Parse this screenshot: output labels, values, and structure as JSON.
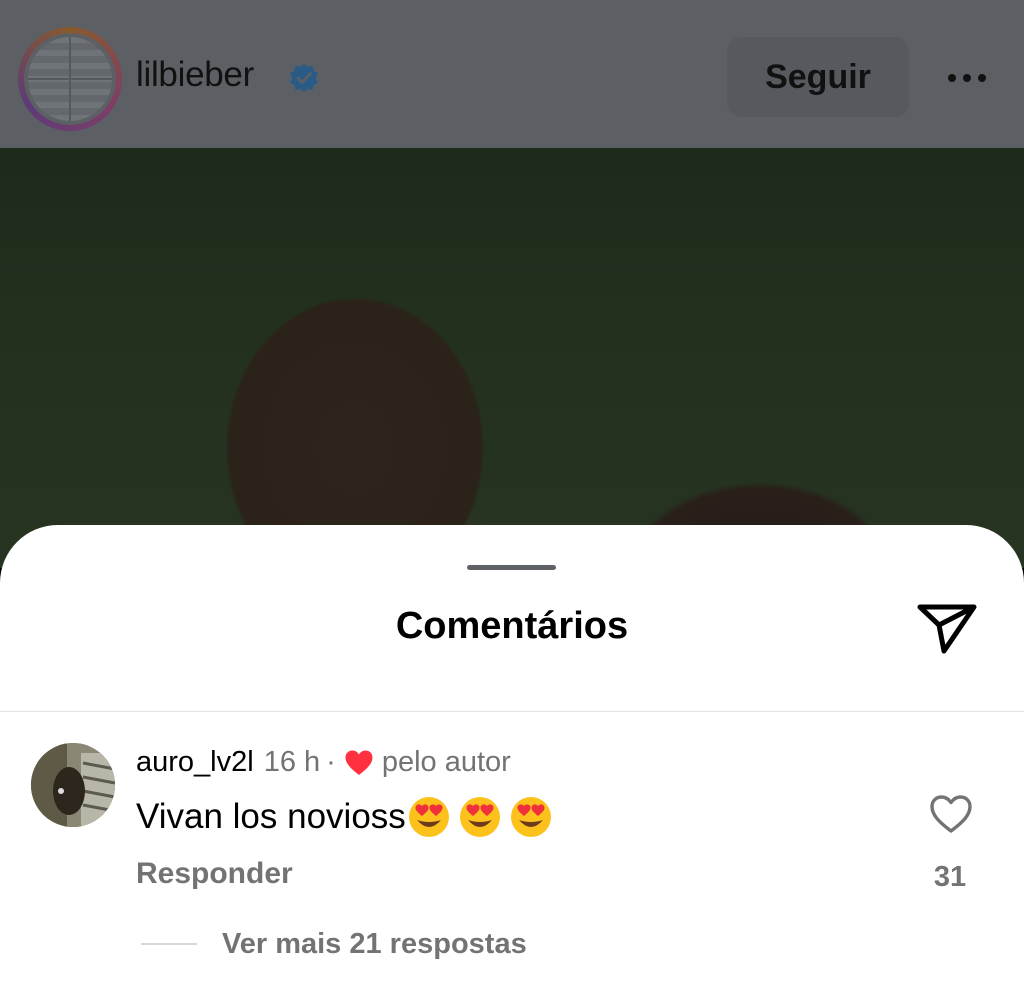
{
  "post": {
    "username": "lilbieber",
    "follow_label": "Seguir"
  },
  "comments_sheet": {
    "title": "Comentários",
    "comment": {
      "username": "auro_lv2l",
      "time": "16 h",
      "separator": "·",
      "liked_by_author_label": "pelo autor",
      "text": "Vivan los novioss",
      "emojis": [
        "heart-eyes",
        "heart-eyes",
        "heart-eyes"
      ],
      "reply_label": "Responder",
      "like_count": "31",
      "view_more_replies": "Ver mais 21 respostas"
    }
  },
  "colors": {
    "verified_blue": "#3797f0",
    "author_heart": "#ff3040",
    "secondary_text": "#737373"
  },
  "icons": {
    "verified": "verified-badge-icon",
    "more": "more-options-icon",
    "send": "send-icon",
    "like": "heart-outline-icon",
    "author_like": "heart-filled-icon"
  }
}
